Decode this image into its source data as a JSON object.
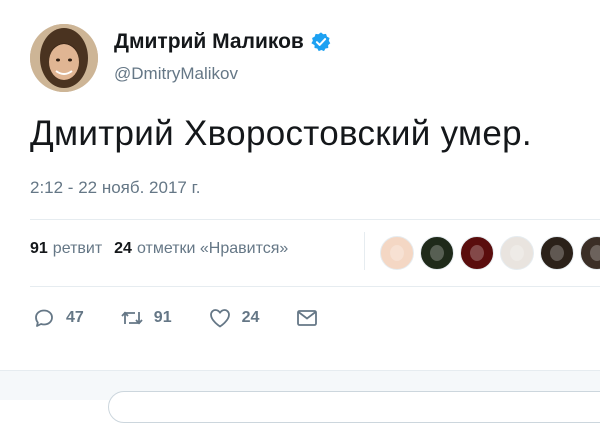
{
  "author": {
    "name": "Дмитрий Маликов",
    "handle": "@DmitryMalikov",
    "verified": true,
    "avatar_icon": "user-avatar"
  },
  "tweet": {
    "text": "Дмитрий Хворостовский умер.",
    "timestamp": "2:12 - 22 нояб. 2017 г."
  },
  "stats": {
    "retweets_count": "91",
    "retweets_label": "ретвит",
    "likes_count": "24",
    "likes_label": "отметки «Нравится»"
  },
  "likers": [
    {
      "icon": "liker-avatar",
      "color": "#f4d7c4"
    },
    {
      "icon": "liker-avatar",
      "color": "#1f2a1a"
    },
    {
      "icon": "liker-avatar",
      "color": "#5a0d0d"
    },
    {
      "icon": "liker-avatar",
      "color": "#e9e4df"
    },
    {
      "icon": "liker-avatar",
      "color": "#2b2119"
    },
    {
      "icon": "liker-avatar",
      "color": "#3b2e26"
    }
  ],
  "actions": {
    "reply_count": "47",
    "retweet_count": "91",
    "like_count": "24"
  },
  "colors": {
    "accent": "#1da1f2",
    "secondary_text": "#657786",
    "divider": "#e6ecf0"
  }
}
